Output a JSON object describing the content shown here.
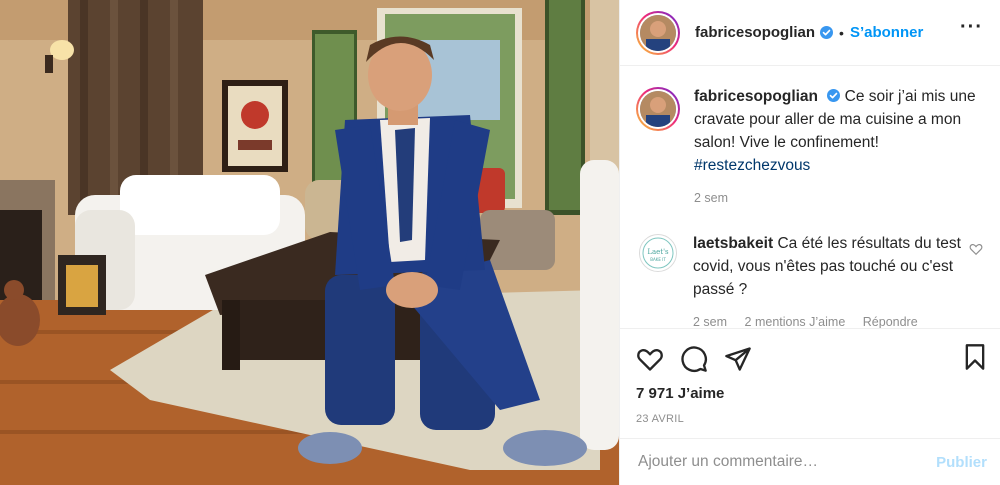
{
  "header": {
    "username": "fabricesopoglian",
    "separator": "•",
    "follow_label": "S’abonner",
    "more_label": "···"
  },
  "caption": {
    "username": "fabricesopoglian",
    "text": "Ce soir j’ai mis une cravate pour aller de ma cuisine a mon salon! Vive le confinement!",
    "hashtag": "#restezchezvous",
    "age": "2 sem"
  },
  "comments": [
    {
      "username": "laetsbakeit",
      "text": "Ca été les résultats du test covid, vous n'êtes pas touché ou c'est passé ?",
      "age": "2 sem",
      "likes": "2 mentions J’aime",
      "reply": "Répondre",
      "avatar_label": "Laet's BAKE IT"
    }
  ],
  "actions": {
    "likes": "7 971 J’aime",
    "date": "23 AVRIL"
  },
  "add_comment": {
    "placeholder": "Ajouter un commentaire…",
    "publish_label": "Publier"
  },
  "icons": {
    "verified": "verified-badge-icon",
    "heart": "heart-icon",
    "comment": "comment-icon",
    "share": "share-icon",
    "save": "bookmark-icon"
  },
  "colors": {
    "link_blue": "#0095f6",
    "publish_disabled": "#b2dffc",
    "hashtag": "#00376b",
    "muted": "#8e8e8e"
  }
}
